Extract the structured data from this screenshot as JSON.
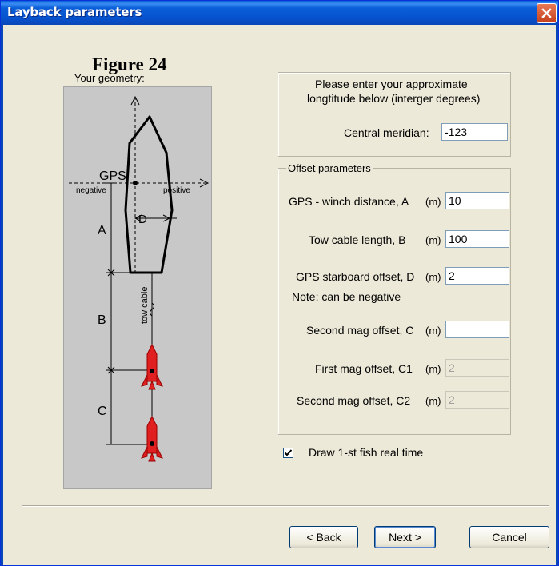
{
  "window": {
    "title": "Layback parameters"
  },
  "figure": {
    "title": "Figure 24",
    "geometry_label": "Your geometry:"
  },
  "diagram": {
    "labels": {
      "gps": "GPS",
      "negative": "negative",
      "positive": "positive",
      "a": "A",
      "b": "B",
      "c": "C",
      "d": "D",
      "tow_cable": "tow cable"
    }
  },
  "meridian": {
    "instruction_line1": "Please enter your approximate",
    "instruction_line2": "longtitude below (interger degrees)",
    "label": "Central meridian:",
    "value": "-123"
  },
  "offsets": {
    "legend": "Offset parameters",
    "unit": "(m)",
    "gps_winch": {
      "label": "GPS - winch distance, A",
      "value": "10"
    },
    "tow_cable": {
      "label": "Tow cable length, B",
      "value": "100"
    },
    "gps_starboard": {
      "label": "GPS starboard offset, D",
      "value": "2"
    },
    "note": "Note: can be negative",
    "second_mag_c": {
      "label": "Second mag offset, C",
      "value": ""
    },
    "first_mag_c1": {
      "label": "First mag offset, C1",
      "value": "2"
    },
    "second_mag_c2": {
      "label": "Second mag offset, C2",
      "value": "2"
    }
  },
  "draw_fish": {
    "label": "Draw 1-st fish real time",
    "checked": true
  },
  "buttons": {
    "back": "< Back",
    "next": "Next >",
    "cancel": "Cancel"
  },
  "icons": {
    "close": "close-icon",
    "check": "check-icon"
  },
  "colors": {
    "titlebar": "#0a5fd8",
    "close": "#c5401c",
    "dialog_bg": "#ece9d8",
    "diagram_bg": "#c8c8c8",
    "fish": "#e02020"
  }
}
